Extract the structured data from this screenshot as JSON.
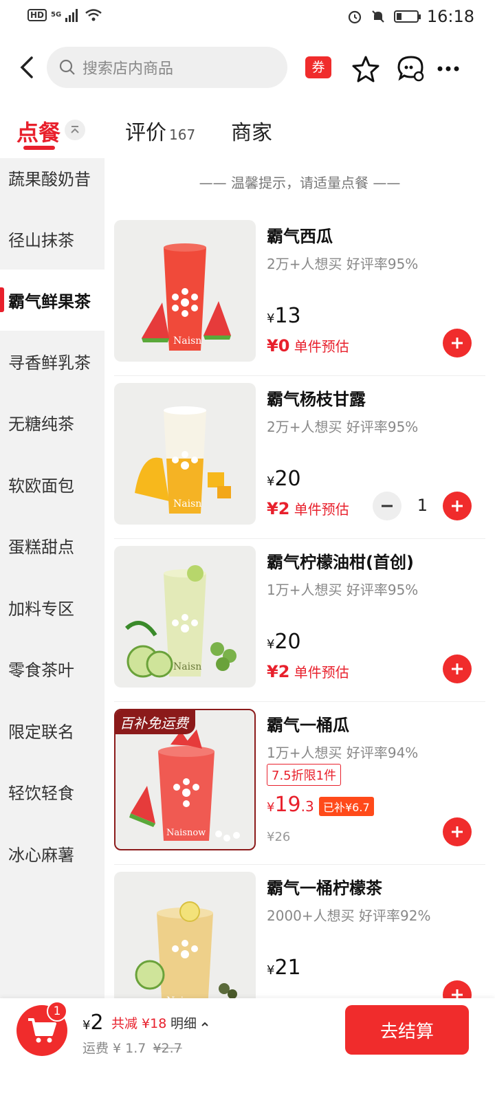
{
  "status_bar": {
    "hd": "HD",
    "network": "5G",
    "time": "16:18"
  },
  "header": {
    "search_placeholder": "搜索店内商品",
    "coupon_label": "券"
  },
  "tabs": [
    {
      "label": "点餐",
      "active": true
    },
    {
      "label": "评价",
      "count": "167"
    },
    {
      "label": "商家"
    }
  ],
  "sidebar": {
    "categories": [
      "蔬果酸奶昔",
      "径山抹茶",
      "霸气鲜果茶",
      "寻香鲜乳茶",
      "无糖纯茶",
      "软欧面包",
      "蛋糕甜点",
      "加料专区",
      "零食茶叶",
      "限定联名",
      "轻饮轻食",
      "冰心麻薯"
    ],
    "active_index": 2
  },
  "content": {
    "tip": "温馨提示，请适量点餐",
    "items": [
      {
        "name": "霸气西瓜",
        "meta": "2万+人想买  好评率95%",
        "currency": "¥",
        "price": "13",
        "est_price": "¥0",
        "est_label": "单件预估",
        "accent": "#f04a3a",
        "fruit": "watermelon"
      },
      {
        "name": "霸气杨枝甘露",
        "meta": "2万+人想买  好评率95%",
        "currency": "¥",
        "price": "20",
        "est_price": "¥2",
        "est_label": "单件预估",
        "quantity": "1",
        "accent": "#f5b324",
        "fruit": "mango"
      },
      {
        "name": "霸气柠檬油柑(首创)",
        "meta": "1万+人想买  好评率95%",
        "currency": "¥",
        "price": "20",
        "est_price": "¥2",
        "est_label": "单件预估",
        "accent": "#d7e49a",
        "fruit": "lime"
      },
      {
        "name": "霸气一桶瓜",
        "meta": "1万+人想买  好评率94%",
        "promo_tag": "百补免运费",
        "discount": "7.5折限1件",
        "currency": "¥",
        "price_int": "19",
        "price_dec": ".3",
        "subsidy": "已补¥6.7",
        "orig_price": "¥26",
        "accent": "#f05a52",
        "fruit": "watermelon"
      },
      {
        "name": "霸气一桶柠檬茶",
        "meta": "2000+人想买  好评率92%",
        "currency": "¥",
        "price": "21",
        "accent": "#e9c36a",
        "fruit": "lemon"
      }
    ]
  },
  "cart": {
    "badge": "1",
    "currency": "¥",
    "total": "2",
    "save_text": "共减 ¥18",
    "detail_text": "明细",
    "ship_label": "运费 ¥ 1.7",
    "ship_orig": "¥2.7",
    "checkout_label": "去结算"
  },
  "colors": {
    "brand_red": "#f02c2c",
    "promo_dark_red": "#8b1a1a"
  }
}
